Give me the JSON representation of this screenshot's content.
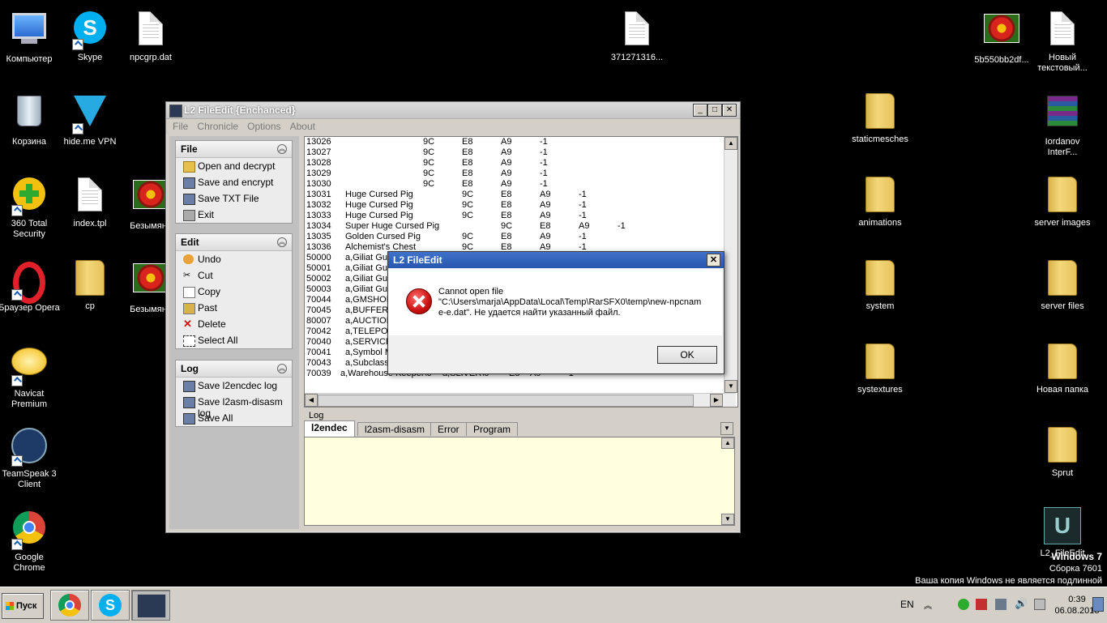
{
  "desktop": {
    "left_col": [
      {
        "label": "Компьютер",
        "icon": "computer-icon"
      },
      {
        "label": "Корзина",
        "icon": "recycle-bin-icon"
      },
      {
        "label": "360 Total Security",
        "icon": "security-icon"
      },
      {
        "label": "Браузер Opera",
        "icon": "opera-icon"
      },
      {
        "label": "Navicat Premium",
        "icon": "navicat-icon"
      },
      {
        "label": "TeamSpeak 3 Client",
        "icon": "teamspeak-icon"
      },
      {
        "label": "Google Chrome",
        "icon": "chrome-icon"
      }
    ],
    "second_col": [
      {
        "label": "Skype",
        "icon": "skype-icon"
      },
      {
        "label": "hide.me VPN",
        "icon": "vpn-icon"
      },
      {
        "label": "index.tpl",
        "icon": "document-icon"
      },
      {
        "label": "cp",
        "icon": "folder-icon"
      }
    ],
    "third_col": [
      {
        "label": "npcgrp.dat",
        "icon": "file-icon"
      },
      {
        "label": "Безымянн",
        "icon": "image-icon"
      },
      {
        "label": "Безымянн",
        "icon": "image-icon"
      }
    ],
    "top_mid": {
      "label": "371271316...",
      "icon": "file-icon"
    },
    "right_a": [
      {
        "label": "5b550bb2df...",
        "icon": "image-icon"
      },
      {
        "label": "staticmesches",
        "icon": "folder-icon"
      },
      {
        "label": "animations",
        "icon": "folder-icon"
      },
      {
        "label": "system",
        "icon": "folder-icon"
      },
      {
        "label": "systextures",
        "icon": "folder-icon"
      }
    ],
    "right_b": [
      {
        "label": "Новый текстовый...",
        "icon": "document-icon"
      },
      {
        "label": "Iordanov InterF...",
        "icon": "archive-icon"
      },
      {
        "label": "server images",
        "icon": "folder-icon"
      },
      {
        "label": "server files",
        "icon": "folder-icon"
      },
      {
        "label": "Новая папка",
        "icon": "folder-icon"
      },
      {
        "label": "Sprut",
        "icon": "folder-icon"
      },
      {
        "label": "L2_FileEdit",
        "icon": "unreal-icon"
      }
    ]
  },
  "window": {
    "title": "L2 FileEdit {Enchanced}",
    "menu": [
      "File",
      "Chronicle",
      "Options",
      "About"
    ],
    "groups": [
      {
        "title": "File",
        "items": [
          "Open and decrypt",
          "Save and encrypt",
          "Save TXT File",
          "Exit"
        ]
      },
      {
        "title": "Edit",
        "items": [
          "Undo",
          "Cut",
          "Copy",
          "Past",
          "Delete",
          "Select All"
        ]
      },
      {
        "title": "Log",
        "items": [
          "Save l2encdec log",
          "Save l2asm-disasm log",
          "Save All"
        ]
      }
    ],
    "rows": [
      [
        "13026",
        "",
        "9C",
        "E8",
        "A9",
        "-1"
      ],
      [
        "13027",
        "",
        "9C",
        "E8",
        "A9",
        "-1"
      ],
      [
        "13028",
        "",
        "9C",
        "E8",
        "A9",
        "-1"
      ],
      [
        "13029",
        "",
        "9C",
        "E8",
        "A9",
        "-1"
      ],
      [
        "13030",
        "",
        "9C",
        "E8",
        "A9",
        "-1"
      ],
      [
        "13031",
        "Huge Cursed Pig",
        "9C",
        "E8",
        "A9",
        "-1"
      ],
      [
        "13032",
        "Huge Cursed Pig",
        "9C",
        "E8",
        "A9",
        "-1"
      ],
      [
        "13033",
        "Huge Cursed Pig",
        "9C",
        "E8",
        "A9",
        "-1"
      ],
      [
        "13034",
        "Super Huge Cursed Pig",
        "9C",
        "E8",
        "A9",
        "-1"
      ],
      [
        "13035",
        "Golden Cursed Pig",
        "9C",
        "E8",
        "A9",
        "-1"
      ],
      [
        "13036",
        "Alchemist's Chest",
        "9C",
        "E8",
        "A9",
        "-1"
      ],
      [
        "50000",
        "a,Giliat Guar",
        "",
        "",
        "",
        ""
      ],
      [
        "50001",
        "a,Giliat Guar",
        "",
        "",
        "",
        ""
      ],
      [
        "50002",
        "a,Giliat Guar",
        "",
        "",
        "",
        ""
      ],
      [
        "50003",
        "a,Giliat Guar",
        "",
        "",
        "",
        ""
      ],
      [
        "70044",
        "a,GMSHOP",
        "",
        "",
        "",
        ""
      ],
      [
        "70045",
        "a,BUFFER \\",
        "",
        "",
        "",
        ""
      ],
      [
        "80007",
        "a,AUCTION",
        "",
        "",
        "",
        ""
      ],
      [
        "70042",
        "a,TELEPOR",
        "",
        "",
        "",
        ""
      ],
      [
        "70040",
        "a,SERVICE",
        "",
        "",
        "",
        ""
      ],
      [
        "70041",
        "a,Symbol Ma",
        "",
        "",
        "",
        ""
      ],
      [
        "70043",
        "a,Subclass M",
        "",
        "",
        "",
        ""
      ],
      [
        "70039",
        "a,Warehouse Keeper\\0",
        "a,SLIVER\\0",
        "E8",
        "A9",
        "-1"
      ]
    ],
    "log_caption": "Log",
    "tabs": [
      "l2endec",
      "l2asm-disasm",
      "Error",
      "Program"
    ]
  },
  "dialog": {
    "title": "L2 FileEdit",
    "line1": "Cannot open file",
    "line2": "\"C:\\Users\\marja\\AppData\\Local\\Temp\\RarSFX0\\temp\\new-npcnam",
    "line3": "e-e.dat\". Не удается найти указанный файл.",
    "ok": "OK",
    "close": "✕"
  },
  "taskbar": {
    "start": "Пуск",
    "lang": "EN",
    "time": "0:39",
    "date": "06.08.2018"
  },
  "watermark": {
    "line1": "Windows 7",
    "line2": "Сборка 7601",
    "line3": "Ваша копия Windows не является подлинной"
  },
  "colors": {
    "dialog_title": "#2756ad",
    "log_bg": "#ffffe0",
    "error_red": "#cc1010"
  }
}
